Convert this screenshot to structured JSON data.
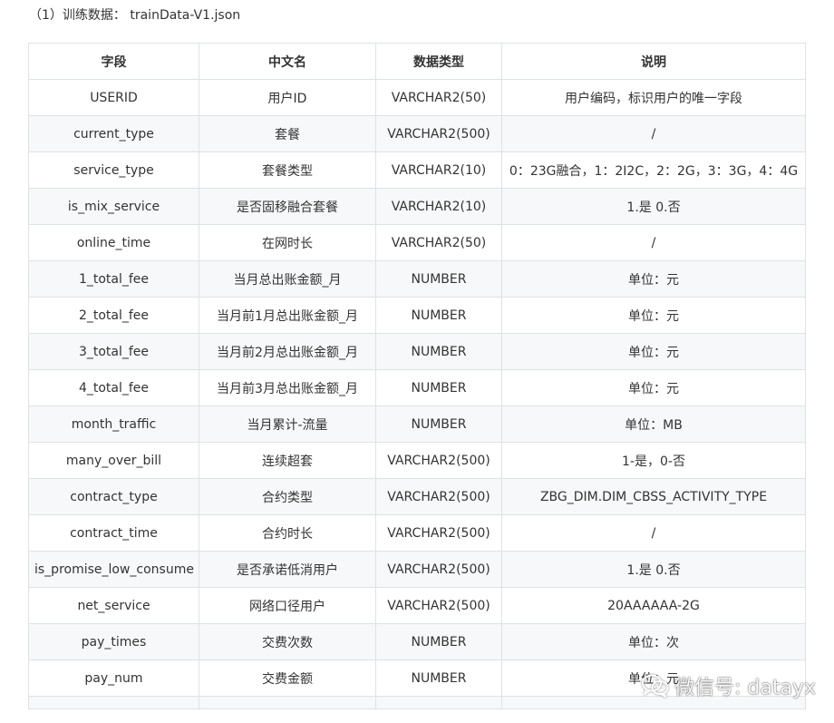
{
  "caption": "（1）训练数据： trainData-V1.json",
  "table": {
    "headers": [
      "字段",
      "中文名",
      "数据类型",
      "说明"
    ],
    "rows": [
      [
        "USERID",
        "用户ID",
        "VARCHAR2(50)",
        "用户编码，标识用户的唯一字段"
      ],
      [
        "current_type",
        "套餐",
        "VARCHAR2(500)",
        "/"
      ],
      [
        "service_type",
        "套餐类型",
        "VARCHAR2(10)",
        "0：23G融合，1：2I2C，2：2G，3：3G，4：4G"
      ],
      [
        "is_mix_service",
        "是否固移融合套餐",
        "VARCHAR2(10)",
        "1.是 0.否"
      ],
      [
        "online_time",
        "在网时长",
        "VARCHAR2(50)",
        "/"
      ],
      [
        "1_total_fee",
        "当月总出账金额_月",
        "NUMBER",
        "单位：元"
      ],
      [
        "2_total_fee",
        "当月前1月总出账金额_月",
        "NUMBER",
        "单位：元"
      ],
      [
        "3_total_fee",
        "当月前2月总出账金额_月",
        "NUMBER",
        "单位：元"
      ],
      [
        "4_total_fee",
        "当月前3月总出账金额_月",
        "NUMBER",
        "单位：元"
      ],
      [
        "month_traffic",
        "当月累计-流量",
        "NUMBER",
        "单位：MB"
      ],
      [
        "many_over_bill",
        "连续超套",
        "VARCHAR2(500)",
        "1-是，0-否"
      ],
      [
        "contract_type",
        "合约类型",
        "VARCHAR2(500)",
        "ZBG_DIM.DIM_CBSS_ACTIVITY_TYPE"
      ],
      [
        "contract_time",
        "合约时长",
        "VARCHAR2(500)",
        "/"
      ],
      [
        "is_promise_low_consume",
        "是否承诺低消用户",
        "VARCHAR2(500)",
        "1.是 0.否"
      ],
      [
        "net_service",
        "网络口径用户",
        "VARCHAR2(500)",
        "20AAAAAA-2G"
      ],
      [
        "pay_times",
        "交费次数",
        "NUMBER",
        "单位：次"
      ],
      [
        "pay_num",
        "交费金额",
        "NUMBER",
        "单位：元"
      ]
    ]
  },
  "watermark": {
    "text": "微信号: datayx",
    "icon": "wechat-icon"
  }
}
